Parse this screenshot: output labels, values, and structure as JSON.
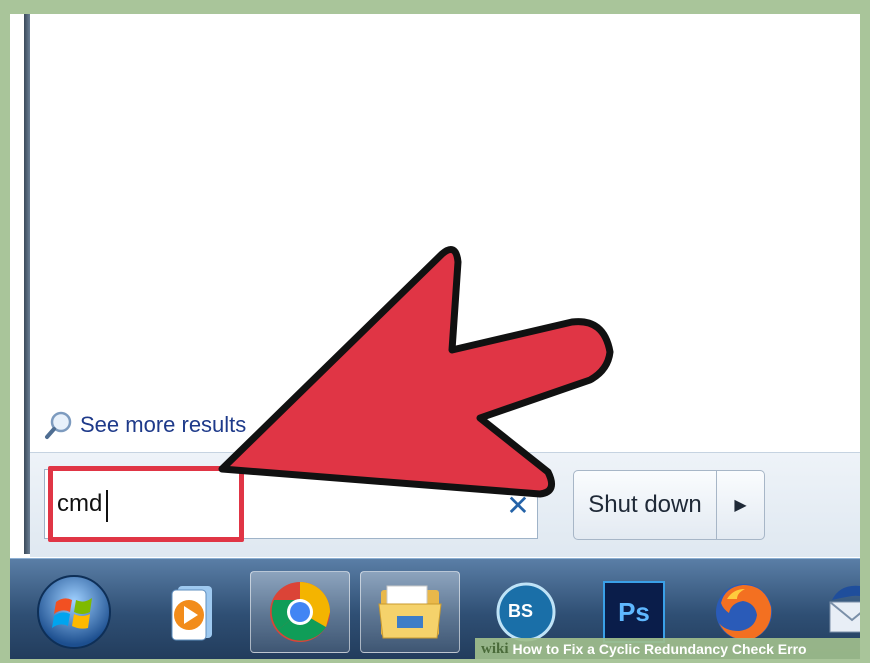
{
  "start_menu": {
    "see_more_label": "See more results",
    "search": {
      "value": "cmd",
      "clear_glyph": "✕"
    },
    "shutdown": {
      "label": "Shut down",
      "arrow_glyph": "▶"
    }
  },
  "taskbar": {
    "items": [
      "start-orb",
      "media-player",
      "chrome",
      "windows-explorer",
      "bs-player",
      "photoshop",
      "firefox",
      "thunderbird"
    ],
    "photoshop_label": "Ps",
    "bs_label": "BS"
  },
  "caption": {
    "wiki_label": "wiki",
    "title": "How to Fix a Cyclic Redundancy Check Erro"
  },
  "colors": {
    "annotation_red": "#e03545",
    "taskbar_blue": "#2f4f74",
    "link_blue": "#1e3a8a",
    "border_green": "#a9c59a"
  }
}
